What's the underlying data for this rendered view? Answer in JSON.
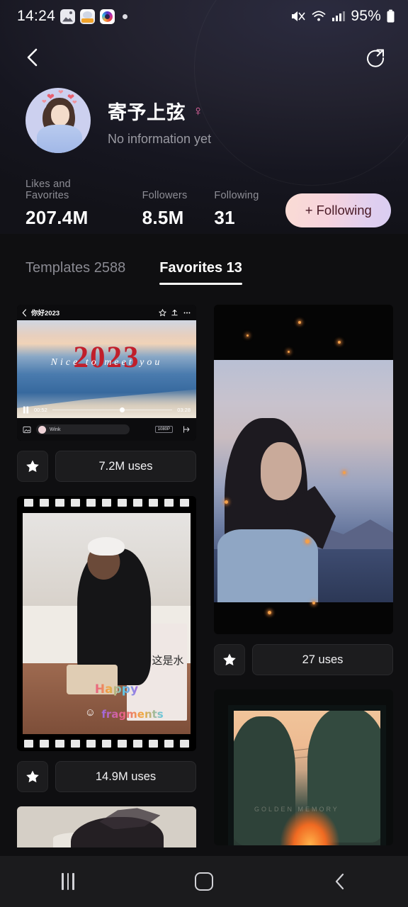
{
  "status_bar": {
    "time": "14:24",
    "battery_text": "95%",
    "icons": [
      "gallery-app-icon",
      "cat-app-icon",
      "camera-app-icon",
      "notification-dot",
      "mute-icon",
      "wifi-icon",
      "signal-icon",
      "battery-icon"
    ]
  },
  "nav": {
    "back_icon": "back-chevron-icon",
    "share_icon": "share-circle-icon"
  },
  "profile": {
    "name": "寄予上弦",
    "gender_symbol": "♀",
    "bio": "No information yet",
    "avatar_alt": "user-avatar"
  },
  "stats": [
    {
      "label": "Likes and Favorites",
      "value": "207.4M"
    },
    {
      "label": "Followers",
      "value": "8.5M"
    },
    {
      "label": "Following",
      "value": "31"
    }
  ],
  "follow_button": {
    "label": "+ Following",
    "gradient_from": "#fadcd4",
    "gradient_to": "#d9cdf2",
    "text_color": "#4a1a26"
  },
  "tabs": [
    {
      "label": "Templates 2588",
      "active": false
    },
    {
      "label": "Favorites 13",
      "active": true
    }
  ],
  "cards": [
    {
      "id": "card-2023-video",
      "uses": "7.2M uses",
      "favorited": true,
      "inner": {
        "title": "你好2023",
        "big_text": "2023",
        "script_text": "Nice to meet you",
        "time_current": "00:52",
        "time_total": "03:28",
        "app_label": "Wink",
        "resolution": "1080P"
      }
    },
    {
      "id": "card-portrait-sea",
      "uses": "27 uses",
      "favorited": true
    },
    {
      "id": "card-filmstrip-photo",
      "uses": "14.9M uses",
      "favorited": true,
      "inner": {
        "overlay_happy": "Happy",
        "overlay_fragments": "fragments",
        "sign_text": "这是水"
      }
    },
    {
      "id": "card-trees-sunset",
      "uses": "",
      "favorited": false,
      "inner": {
        "faint_text": "GOLDEN MEMORY"
      }
    },
    {
      "id": "card-hair-partial",
      "uses": "",
      "favorited": false
    }
  ],
  "bottom_nav": [
    {
      "name": "recents-button",
      "icon": "recents-icon"
    },
    {
      "name": "home-button",
      "icon": "home-icon"
    },
    {
      "name": "back-button",
      "icon": "back-icon"
    }
  ],
  "colors": {
    "background": "#0f0f11",
    "card_surface": "#1c1c1e",
    "accent_pink": "#f06ba8",
    "text_muted": "#8e8e96"
  }
}
